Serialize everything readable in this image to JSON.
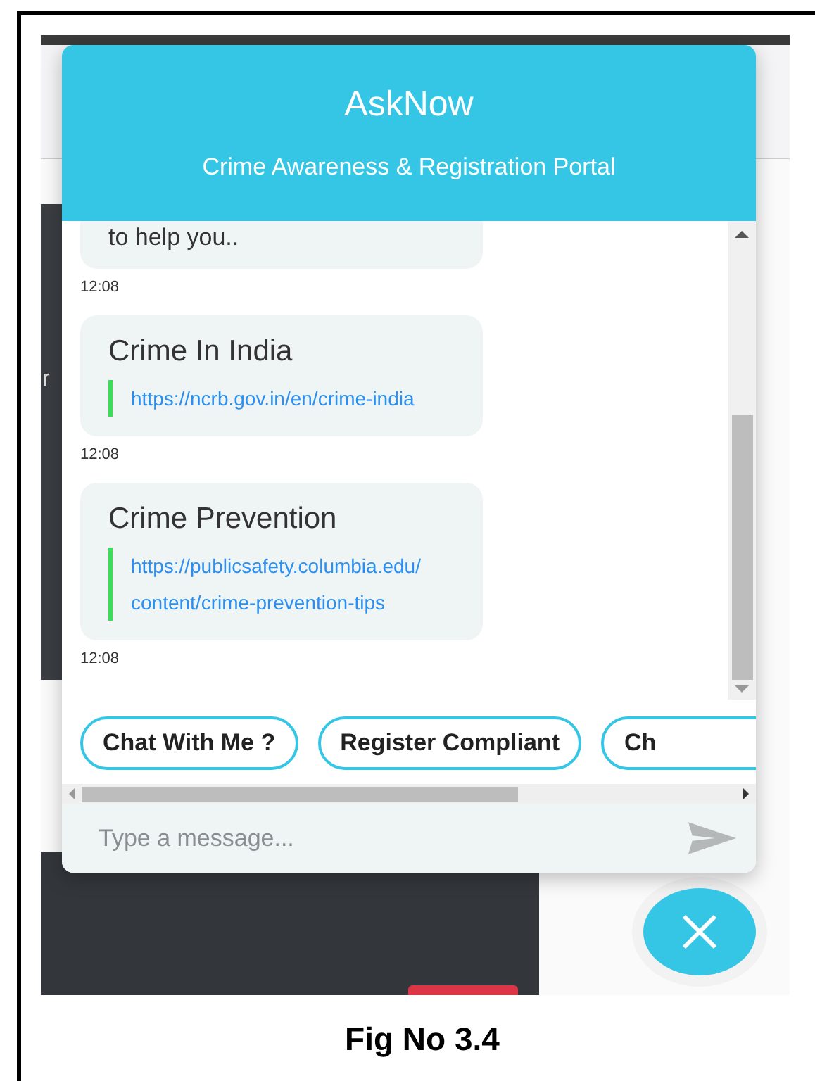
{
  "header": {
    "title": "AskNow",
    "subtitle": "Crime Awareness & Registration Portal"
  },
  "backdrop": {
    "side_text": "r"
  },
  "messages": [
    {
      "kind": "text",
      "text": "to help you..",
      "time": "12:08"
    },
    {
      "kind": "link",
      "title": "Crime In India",
      "url": "https://ncrb.gov.in/en/crime-india",
      "time": "12:08"
    },
    {
      "kind": "link",
      "title": "Crime Prevention",
      "url": "https://publicsafety.columbia.edu/content/crime-prevention-tips",
      "time": "12:08"
    }
  ],
  "quick_replies": [
    "Chat With Me ?",
    "Register Compliant",
    "Ch"
  ],
  "composer": {
    "placeholder": "Type a message..."
  },
  "caption": "Fig No 3.4"
}
